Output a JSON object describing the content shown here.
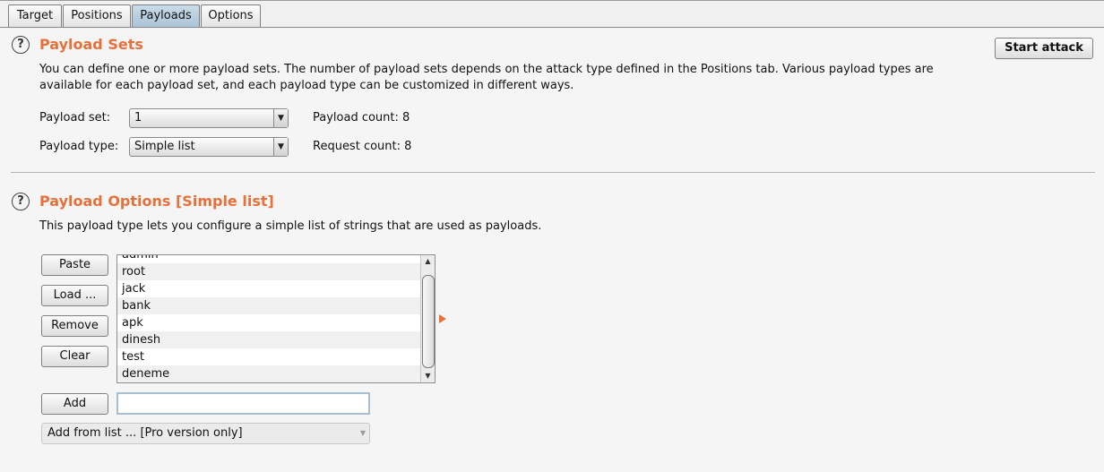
{
  "tabs": [
    "Target",
    "Positions",
    "Payloads",
    "Options"
  ],
  "active_tab": "Payloads",
  "payload_sets": {
    "title": "Payload Sets",
    "help": "?",
    "description_line1": "You can define one or more payload sets. The number of payload sets depends on the attack type defined in the Positions tab. Various payload types are",
    "description_line2": "available for each payload set, and each payload type can be customized in different ways.",
    "payload_set_label": "Payload set:",
    "payload_set_value": "1",
    "payload_type_label": "Payload type:",
    "payload_type_value": "Simple list",
    "payload_count_label": "Payload count:",
    "payload_count_value": "8",
    "request_count_label": "Request count:",
    "request_count_value": "8",
    "start_attack_label": "Start attack"
  },
  "payload_options": {
    "title": "Payload Options [Simple list]",
    "help": "?",
    "description": "This payload type lets you configure a simple list of strings that are used as payloads.",
    "buttons": {
      "paste": "Paste",
      "load": "Load ...",
      "remove": "Remove",
      "clear": "Clear",
      "add": "Add"
    },
    "list_items": [
      "admin",
      "root",
      "jack",
      "bank",
      "apk",
      "dinesh",
      "test",
      "deneme"
    ],
    "add_input_value": "",
    "add_from_list_label": "Add from list ... [Pro version only]"
  },
  "icons": {
    "scroll_up": "▲",
    "scroll_down": "▼",
    "dropdown": "▼"
  },
  "colors": {
    "section_title": "#e8703a",
    "active_tab": "#b7cde0"
  }
}
